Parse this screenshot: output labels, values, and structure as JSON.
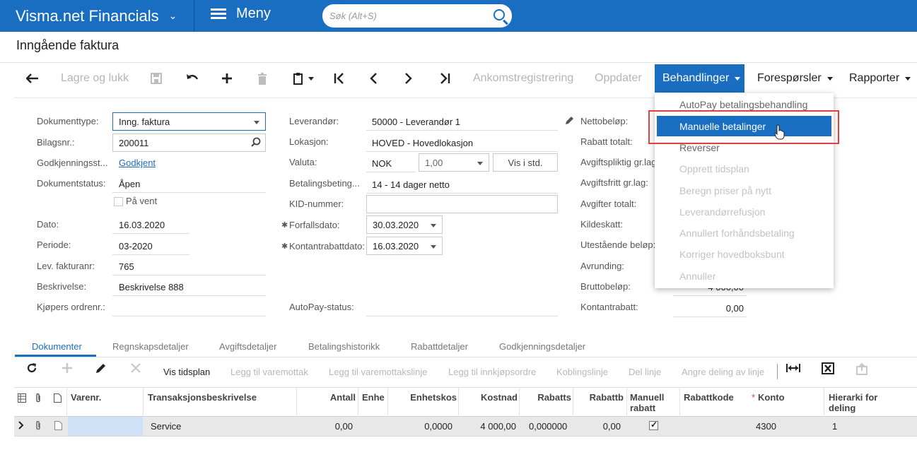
{
  "app": {
    "name": "Visma.net Financials",
    "menu_label": "Meny",
    "search_placeholder": "Søk (Alt+S)"
  },
  "page": {
    "title": "Inngående faktura"
  },
  "toolbar": {
    "save_close": "Lagre og lukk",
    "arrival_registration": "Ankomstregistrering",
    "update": "Oppdater",
    "processing": "Behandlinger",
    "inquiries": "Forespørsler",
    "reports": "Rapporter"
  },
  "processing_menu": {
    "items": [
      {
        "label": "AutoPay betalingsbehandling",
        "enabled": true
      },
      {
        "label": "Manuelle betalinger",
        "enabled": true,
        "selected": true
      },
      {
        "label": "Reverser",
        "enabled": true
      },
      {
        "label": "Opprett tidsplan",
        "enabled": false
      },
      {
        "label": "Beregn priser på nytt",
        "enabled": false
      },
      {
        "label": "Leverandørrefusjon",
        "enabled": false
      },
      {
        "label": "Annullert forhåndsbetaling",
        "enabled": false
      },
      {
        "label": "Korriger hovedboksbunt",
        "enabled": false
      },
      {
        "label": "Annuller",
        "enabled": false
      }
    ]
  },
  "form": {
    "col1": {
      "doc_type_label": "Dokumenttype:",
      "doc_type_value": "Inng. faktura",
      "voucher_label": "Bilagsnr.:",
      "voucher_value": "200011",
      "approval_label": "Godkjenningsst...",
      "approval_value": "Godkjent",
      "doc_status_label": "Dokumentstatus:",
      "doc_status_value": "Åpen",
      "on_hold_label": "På vent",
      "on_hold_checked": false,
      "date_label": "Dato:",
      "date_value": "16.03.2020",
      "period_label": "Periode:",
      "period_value": "03-2020",
      "supplier_invoice_label": "Lev. fakturanr:",
      "supplier_invoice_value": "765",
      "description_label": "Beskrivelse:",
      "description_value": "Beskrivelse 888",
      "buyer_order_label": "Kjøpers ordrenr.:",
      "buyer_order_value": ""
    },
    "col2": {
      "supplier_label": "Leverandør:",
      "supplier_value": "50000 - Leverandør 1",
      "location_label": "Lokasjon:",
      "location_value": "HOVED - Hovedlokasjon",
      "currency_label": "Valuta:",
      "currency_value": "NOK",
      "rate_value": "1,00",
      "view_std_button": "Vis i std.",
      "terms_label": "Betalingsbeting...",
      "terms_value": "14 - 14 dager netto",
      "kid_label": "KID-nummer:",
      "kid_value": "",
      "due_date_label": "Forfallsdato:",
      "due_date_value": "30.03.2020",
      "cash_discount_date_label": "Kontantrabattdato:",
      "cash_discount_date_value": "16.03.2020",
      "autopay_status_label": "AutoPay-status:",
      "autopay_status_value": ""
    },
    "col3": {
      "net_label": "Nettobeløp:",
      "discount_total_label": "Rabatt totalt:",
      "taxable_label": "Avgiftspliktig gr.lag",
      "taxfree_label": "Avgiftsfritt gr.lag:",
      "tax_total_label": "Avgifter totalt:",
      "withholding_label": "Kildeskatt:",
      "outstanding_label": "Utestående beløp:",
      "rounding_label": "Avrunding:",
      "gross_label": "Bruttobeløp:",
      "gross_value": "4 000,00",
      "cash_discount_label": "Kontantrabatt:",
      "cash_discount_value": "0,00"
    }
  },
  "tabs": [
    "Dokumenter",
    "Regnskapsdetaljer",
    "Avgiftsdetaljer",
    "Betalingshistorikk",
    "Rabattdetaljer",
    "Godkjenningsdetaljer"
  ],
  "grid_toolbar": {
    "show_schedule": "Vis tidsplan",
    "add_receipt": "Legg til varemottak",
    "add_receipt_line": "Legg til varemottakslinje",
    "add_purchase_order": "Legg til innkjøpsordre",
    "link_line": "Koblingslinje",
    "split_line": "Del linje",
    "undo_split": "Angre deling av linje"
  },
  "table": {
    "headers": {
      "item_no": "Varenr.",
      "description": "Transaksjonsbeskrivelse",
      "qty": "Antall",
      "unit": "Enhe",
      "unit_cost": "Enhetskos",
      "cost": "Kostnad",
      "discount_pct": "Rabatts",
      "discount_amt": "Rabattb",
      "manual_discount": "Manuell rabatt",
      "discount_code": "Rabattkode",
      "account": "Konto",
      "hierarchy": "Hierarki for deling"
    },
    "rows": [
      {
        "item_no": "",
        "description": "Service",
        "qty": "0,00",
        "unit": "",
        "unit_cost": "0,0000",
        "cost": "4 000,00",
        "discount_pct": "0,000000",
        "discount_amt": "0,00",
        "manual_discount": true,
        "discount_code": "",
        "account": "4300",
        "hierarchy": "1"
      }
    ]
  },
  "colors": {
    "brand": "#1a6ec2",
    "highlight_box": "#e04040",
    "row_selected": "#e8e8e8"
  }
}
